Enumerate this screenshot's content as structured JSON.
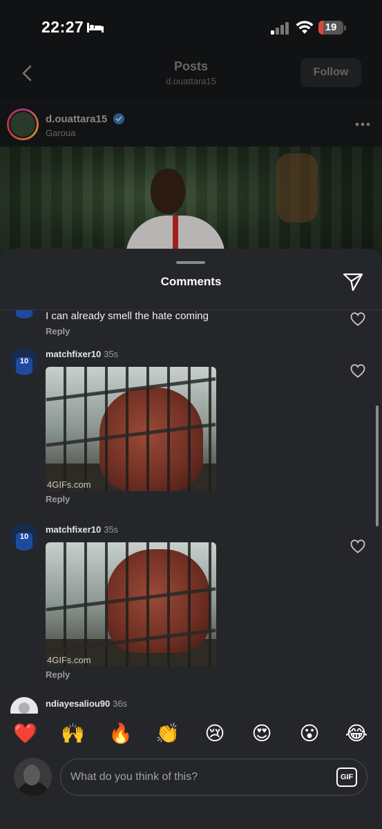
{
  "status_bar": {
    "time": "22:27",
    "battery_level": "19",
    "battery_fraction": 0.19,
    "icons": [
      "bed-icon",
      "cellular-signal-icon",
      "wifi-icon",
      "battery-icon"
    ]
  },
  "header": {
    "title": "Posts",
    "subtitle": "d.ouattara15",
    "follow_label": "Follow"
  },
  "post": {
    "username": "d.ouattara15",
    "location": "Garoua",
    "verified": true
  },
  "comments_sheet": {
    "title": "Comments",
    "comments": [
      {
        "text": "I can already smell the hate coming",
        "reply_label": "Reply"
      },
      {
        "username": "matchfixer10",
        "time": "35s",
        "avatar_number": "10",
        "gif_watermark": "4GIFs.com",
        "reply_label": "Reply"
      },
      {
        "username": "matchfixer10",
        "time": "35s",
        "avatar_number": "10",
        "gif_watermark": "4GIFs.com",
        "reply_label": "Reply"
      },
      {
        "username": "ndiayesaliou90",
        "time": "36s"
      }
    ]
  },
  "reactions": [
    "❤️",
    "🙌",
    "🔥",
    "👏",
    "😢",
    "😍",
    "😮",
    "😂"
  ],
  "composer": {
    "placeholder": "What do you think of this?",
    "gif_label": "GIF"
  },
  "colors": {
    "background": "#000000",
    "sheet": "#25262a",
    "battery_low": "#e0453c",
    "verified_blue": "#3897f0"
  }
}
